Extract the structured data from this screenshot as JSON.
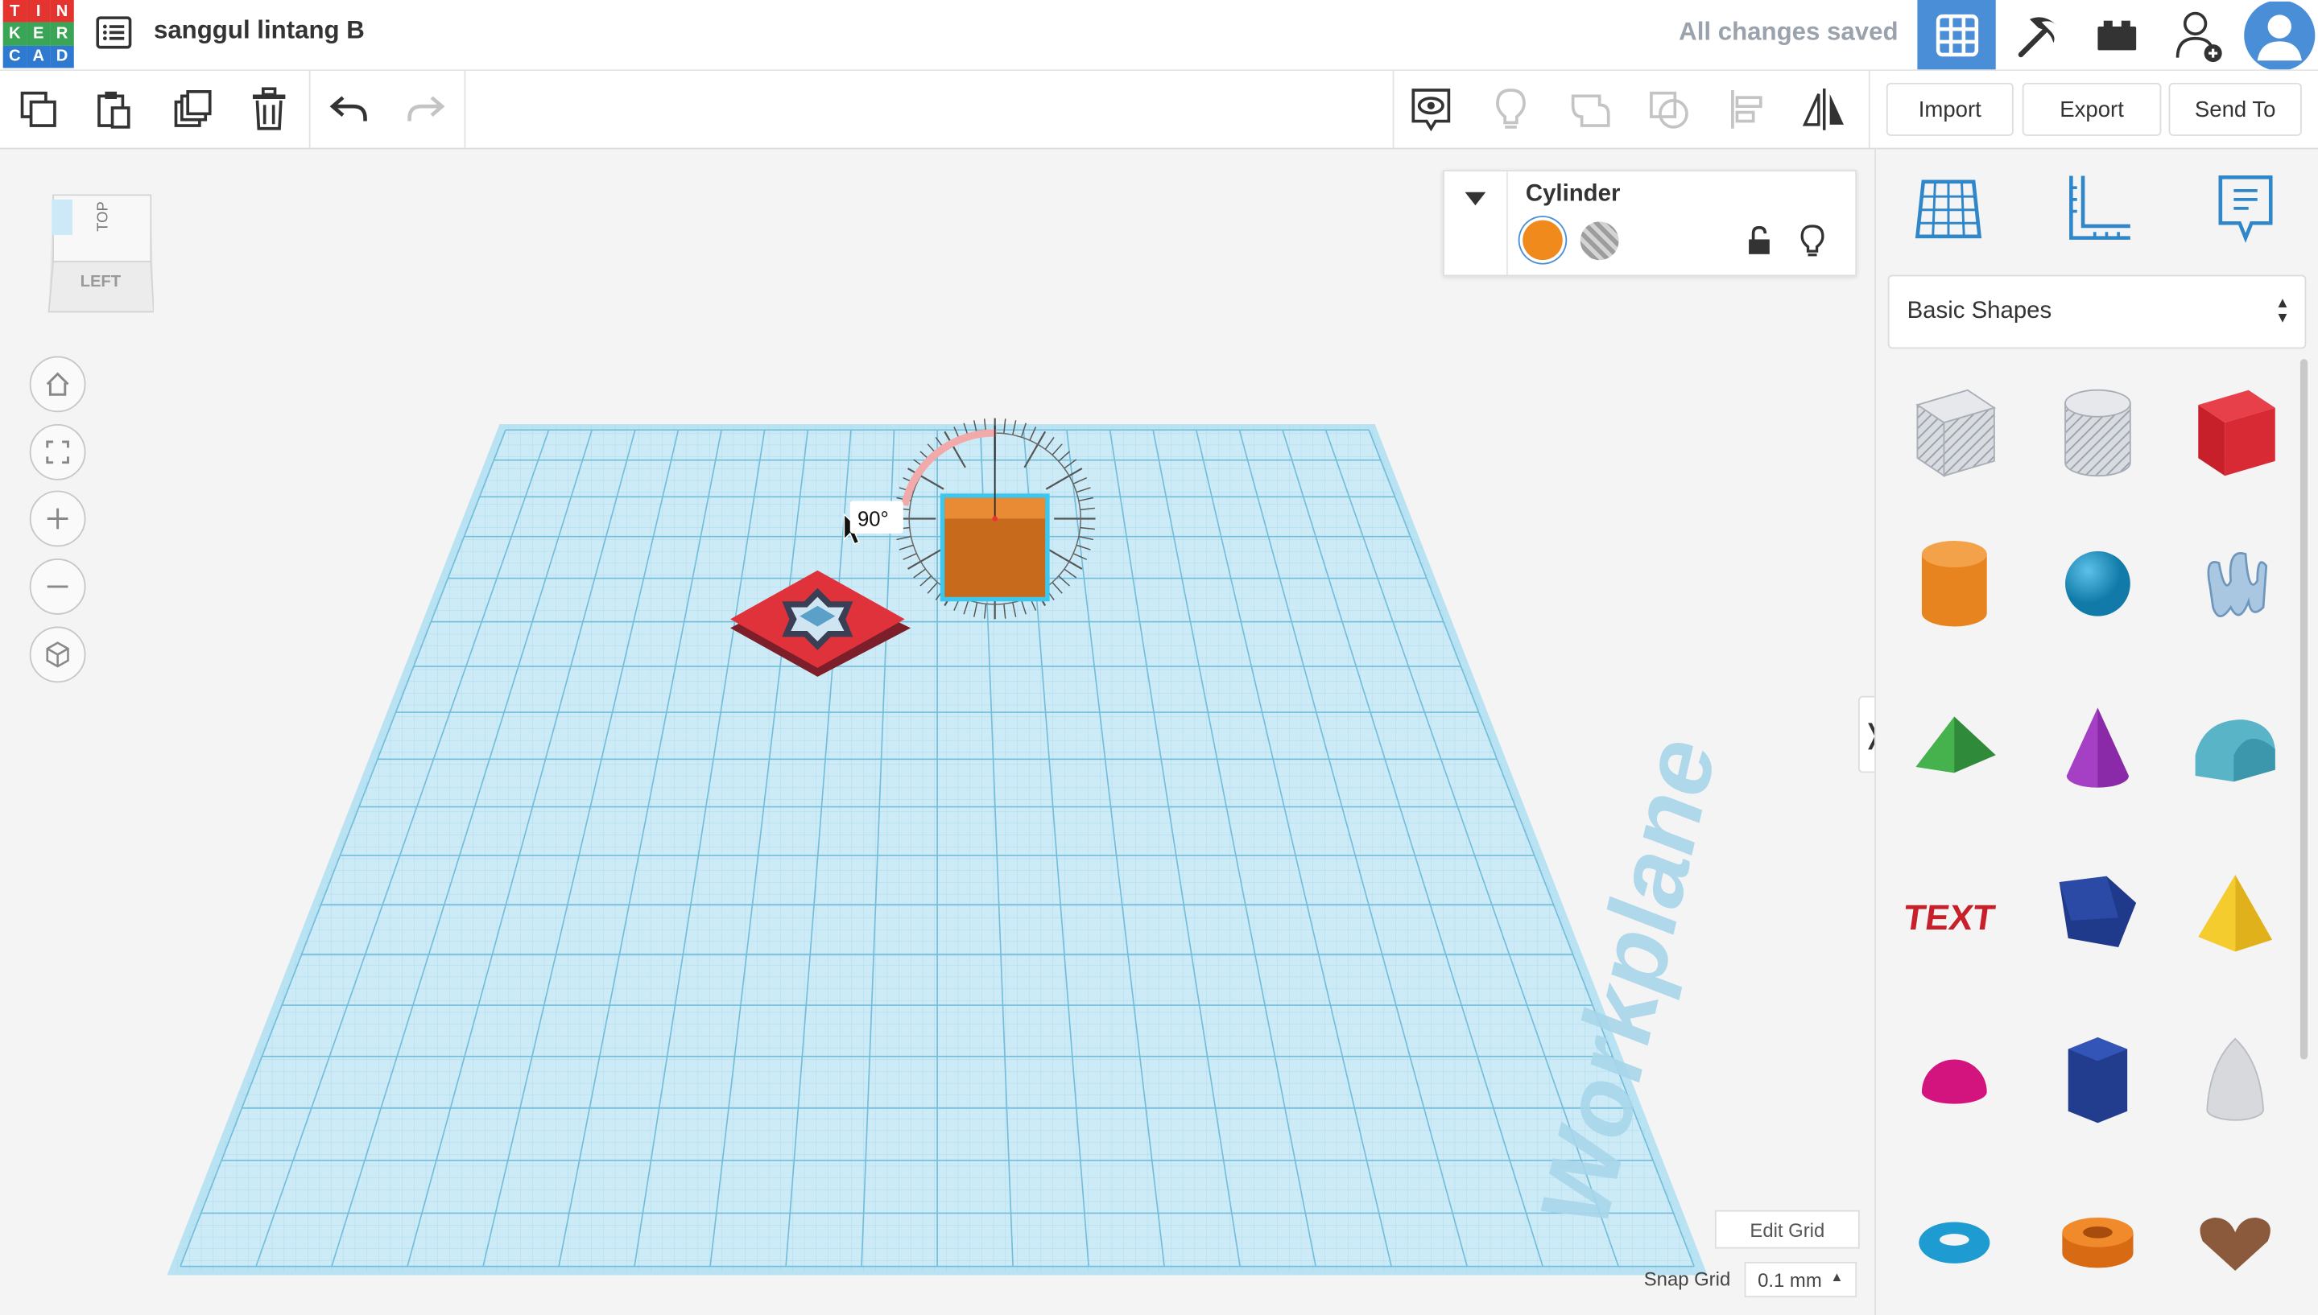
{
  "app": {
    "logo_letters": [
      "T",
      "I",
      "N",
      "K",
      "E",
      "R",
      "C",
      "A",
      "D"
    ],
    "logo_colors": [
      "#e3342f",
      "#e3342f",
      "#e3342f",
      "#3aa556",
      "#3aa556",
      "#3aa556",
      "#2f7ad1",
      "#2f7ad1",
      "#2f7ad1"
    ],
    "document_title": "sanggul lintang B",
    "save_status": "All changes saved"
  },
  "header": {
    "buttons": [
      {
        "name": "3d-design-grid-icon",
        "active": true
      },
      {
        "name": "pickaxe-icon",
        "active": false
      },
      {
        "name": "bricks-icon",
        "active": false
      },
      {
        "name": "add-user-icon",
        "active": false
      },
      {
        "name": "avatar",
        "active": false
      }
    ]
  },
  "toolbar": {
    "left_tools": [
      "copy-icon",
      "paste-icon",
      "duplicate-icon",
      "trash-icon",
      "undo-icon",
      "redo-icon"
    ],
    "right_tools": [
      "notes-visibility-icon",
      "light-bulb-icon",
      "group-icon",
      "ungroup-icon",
      "align-icon",
      "mirror-icon"
    ],
    "import_label": "Import",
    "export_label": "Export",
    "send_to_label": "Send To"
  },
  "viewcube": {
    "face_label": "LEFT",
    "top_label": "TOP"
  },
  "inspector": {
    "shape_name": "Cylinder",
    "solid_color": "#f08a1c"
  },
  "scene": {
    "rotation_readout": "90°",
    "workplane_label": "Workplane"
  },
  "grid_controls": {
    "edit_grid_label": "Edit Grid",
    "snap_grid_label": "Snap Grid",
    "snap_grid_value": "0.1 mm"
  },
  "shapes_panel": {
    "category": "Basic Shapes",
    "shapes": [
      "box-hole",
      "cylinder-hole",
      "box",
      "cylinder",
      "sphere",
      "scribble",
      "roof",
      "cone",
      "round-roof",
      "text",
      "wedge",
      "pyramid",
      "half-sphere",
      "polygon",
      "paraboloid",
      "torus",
      "tube",
      "heart"
    ]
  }
}
